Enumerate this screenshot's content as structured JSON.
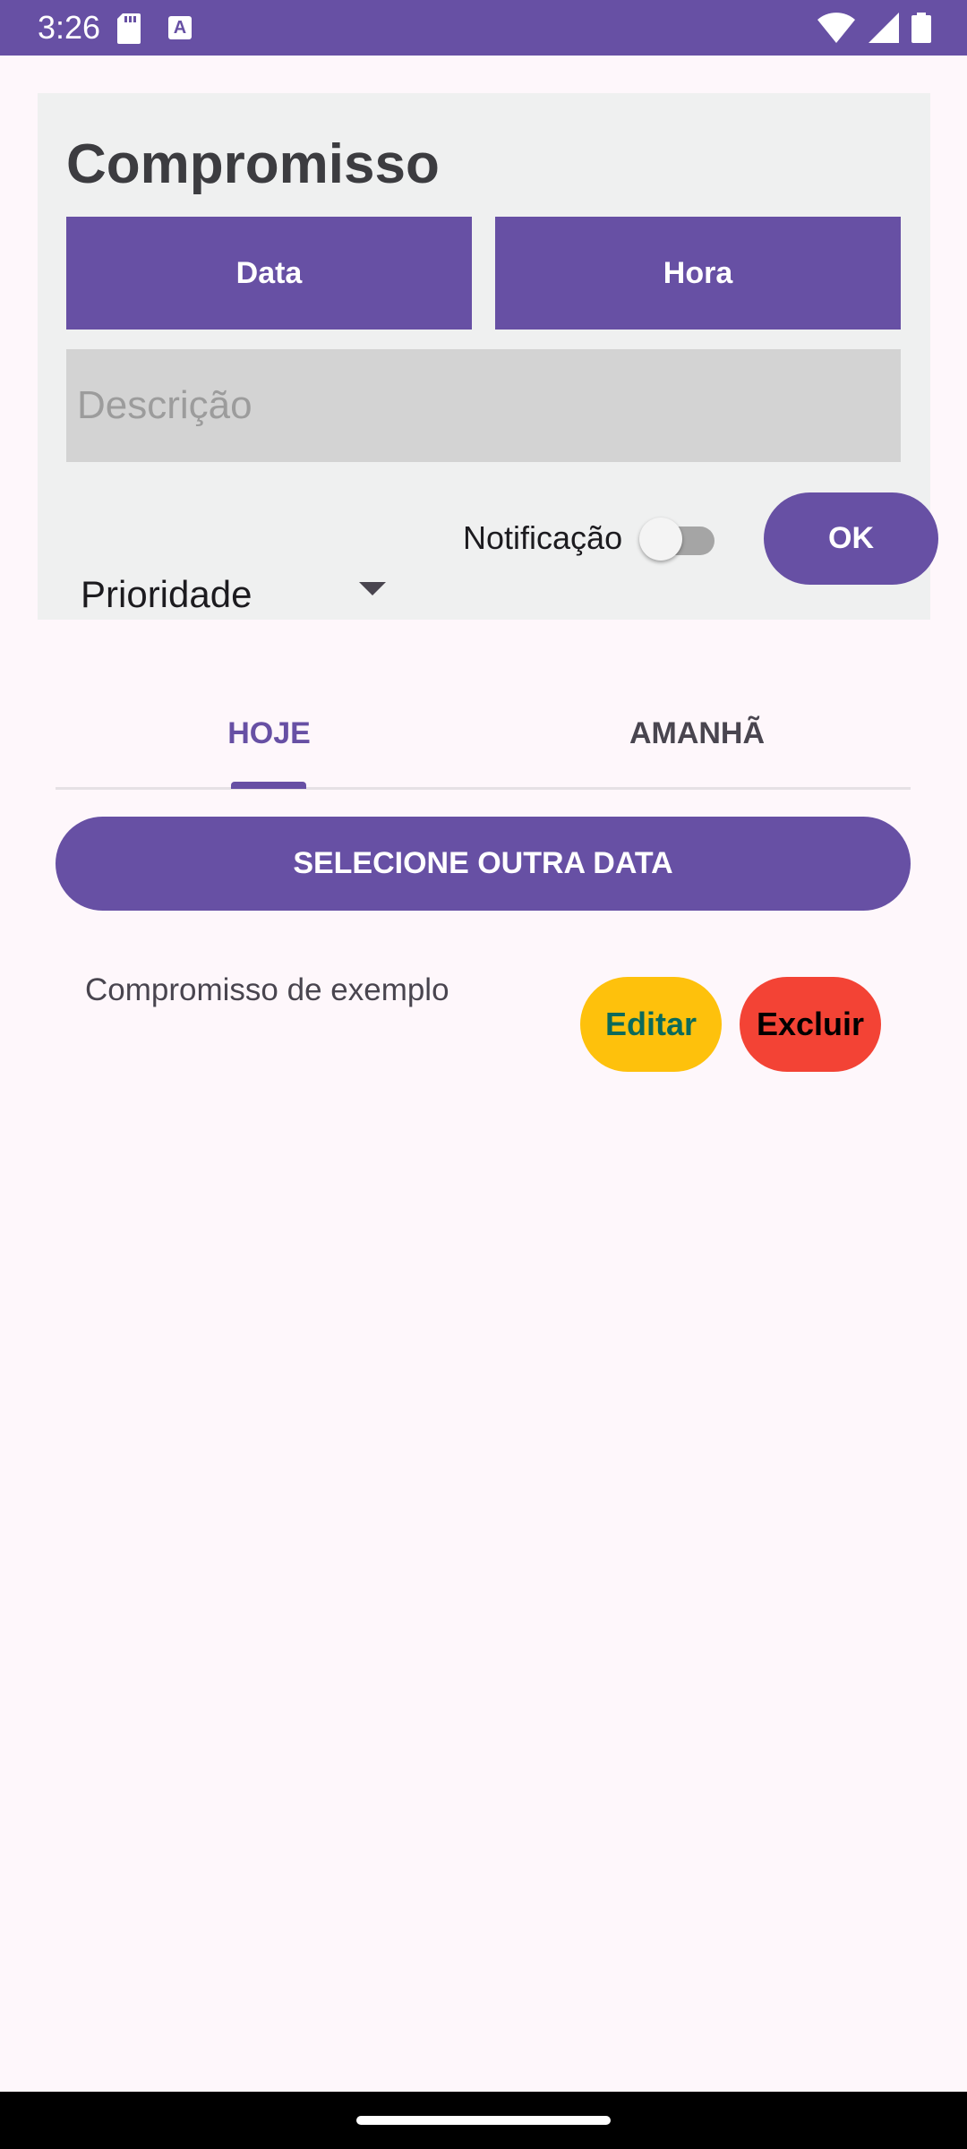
{
  "status_bar": {
    "time": "3:26",
    "background": "#6750a4",
    "icons": [
      "sd-card-icon",
      "a-badge-icon",
      "wifi-icon",
      "signal-icon",
      "battery-icon"
    ]
  },
  "form": {
    "title": "Compromisso",
    "date_button": "Data",
    "time_button": "Hora",
    "description_placeholder": "Descrição",
    "description_value": "",
    "priority_selected": "Prioridade",
    "notification_label": "Notificação",
    "notification_enabled": false,
    "ok_button": "OK"
  },
  "tabs": {
    "items": [
      {
        "label": "HOJE",
        "selected": true
      },
      {
        "label": "AMANHÃ",
        "selected": false
      }
    ]
  },
  "select_date_button": "SELECIONE OUTRA DATA",
  "appointments": [
    {
      "description": "Compromisso de exemplo",
      "edit_label": "Editar",
      "delete_label": "Excluir"
    }
  ],
  "colors": {
    "primary": "#6750a4",
    "edit": "#fec10c",
    "delete": "#f34335",
    "background": "#fef7fb"
  }
}
